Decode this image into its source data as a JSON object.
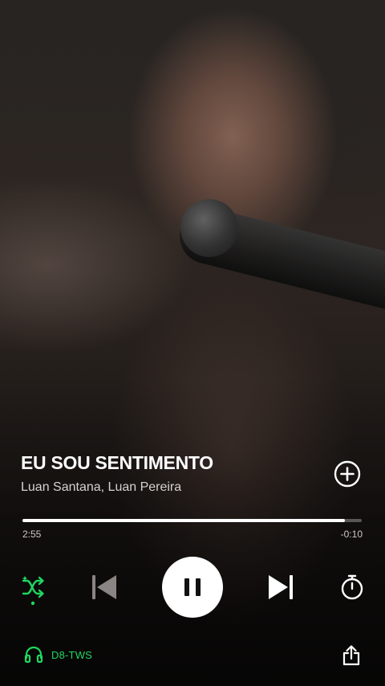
{
  "track": {
    "title": "EU SOU SENTIMENTO",
    "artist": "Luan Santana, Luan Pereira"
  },
  "playback": {
    "elapsed": "2:55",
    "remaining": "-0:10",
    "progress_fraction": 0.95,
    "state": "playing"
  },
  "controls": {
    "shuffle_icon": "shuffle-icon",
    "prev_icon": "skip-previous-icon",
    "pause_icon": "pause-icon",
    "next_icon": "skip-next-icon",
    "timer_icon": "sleep-timer-icon",
    "add_icon": "add-circle-icon",
    "share_icon": "share-icon"
  },
  "device": {
    "name": "D8-TWS",
    "icon": "headphones-icon"
  },
  "colors": {
    "accent": "#1ed760",
    "disabled": "#8a8583"
  }
}
